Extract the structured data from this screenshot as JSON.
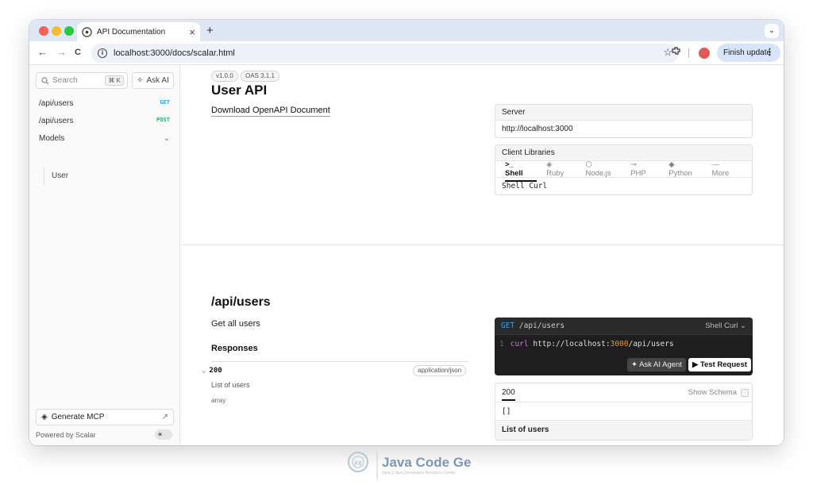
{
  "browser": {
    "tab_title": "API Documentation",
    "tab_close": "×",
    "new_tab": "+",
    "tab_menu": "⌄",
    "url": "localhost:3000/docs/scalar.html",
    "finish_update": "Finish update",
    "back": "←",
    "forward": "→",
    "reload": "C",
    "bookmark": "☆",
    "menu_dots": "⋮"
  },
  "sidebar": {
    "search_placeholder": "Search",
    "search_shortcut": "⌘ K",
    "ask_ai": "Ask AI",
    "items": [
      {
        "label": "/api/users",
        "method": "GET",
        "method_color": "#3aa0e8"
      },
      {
        "label": "/api/users",
        "method": "POST",
        "method_color": "#2fa866"
      },
      {
        "label": "Models",
        "method": "⌄",
        "method_color": "#777777"
      }
    ],
    "child": "User",
    "generate_mcp": "Generate MCP",
    "generate_arrow": "↗",
    "powered_by": "Powered by Scalar",
    "toggle_icon": "☀"
  },
  "main": {
    "version": "v1.0.0",
    "oas": "OAS 3.1.1",
    "title": "User API",
    "download": "Download OpenAPI Document",
    "server_label": "Server",
    "server_url": "http://localhost:3000",
    "client_label": "Client Libraries",
    "langs": [
      "Shell",
      "Ruby",
      "Node.js",
      "PHP",
      "Python",
      "More"
    ],
    "lang_icons": [
      ">_",
      "◈",
      "⬡",
      "⊸",
      "◆",
      "—"
    ],
    "client_selected": "Shell Curl",
    "endpoint_title": "/api/users",
    "endpoint_desc": "Get all users",
    "responses": "Responses",
    "status": "200",
    "content_type": "application/json",
    "response_desc": "List of users",
    "response_type": "array",
    "request": {
      "method": "GET",
      "path": "/api/users",
      "selector": "Shell Curl ⌄",
      "line": "1",
      "cmd": "curl",
      "url_pre": "http://localhost:",
      "port": "3000",
      "url_post": "/api/users",
      "ask_agent": "✦ Ask AI Agent",
      "test_request": "▶ Test Request"
    },
    "response_card": {
      "status": "200",
      "show_schema": "Show Schema",
      "body": "[]",
      "footer": "List of users"
    }
  },
  "watermark": {
    "name": "Java Code Geeks",
    "tagline": "Java 2 Java Developers Resource Center",
    "logo": "jcg"
  }
}
